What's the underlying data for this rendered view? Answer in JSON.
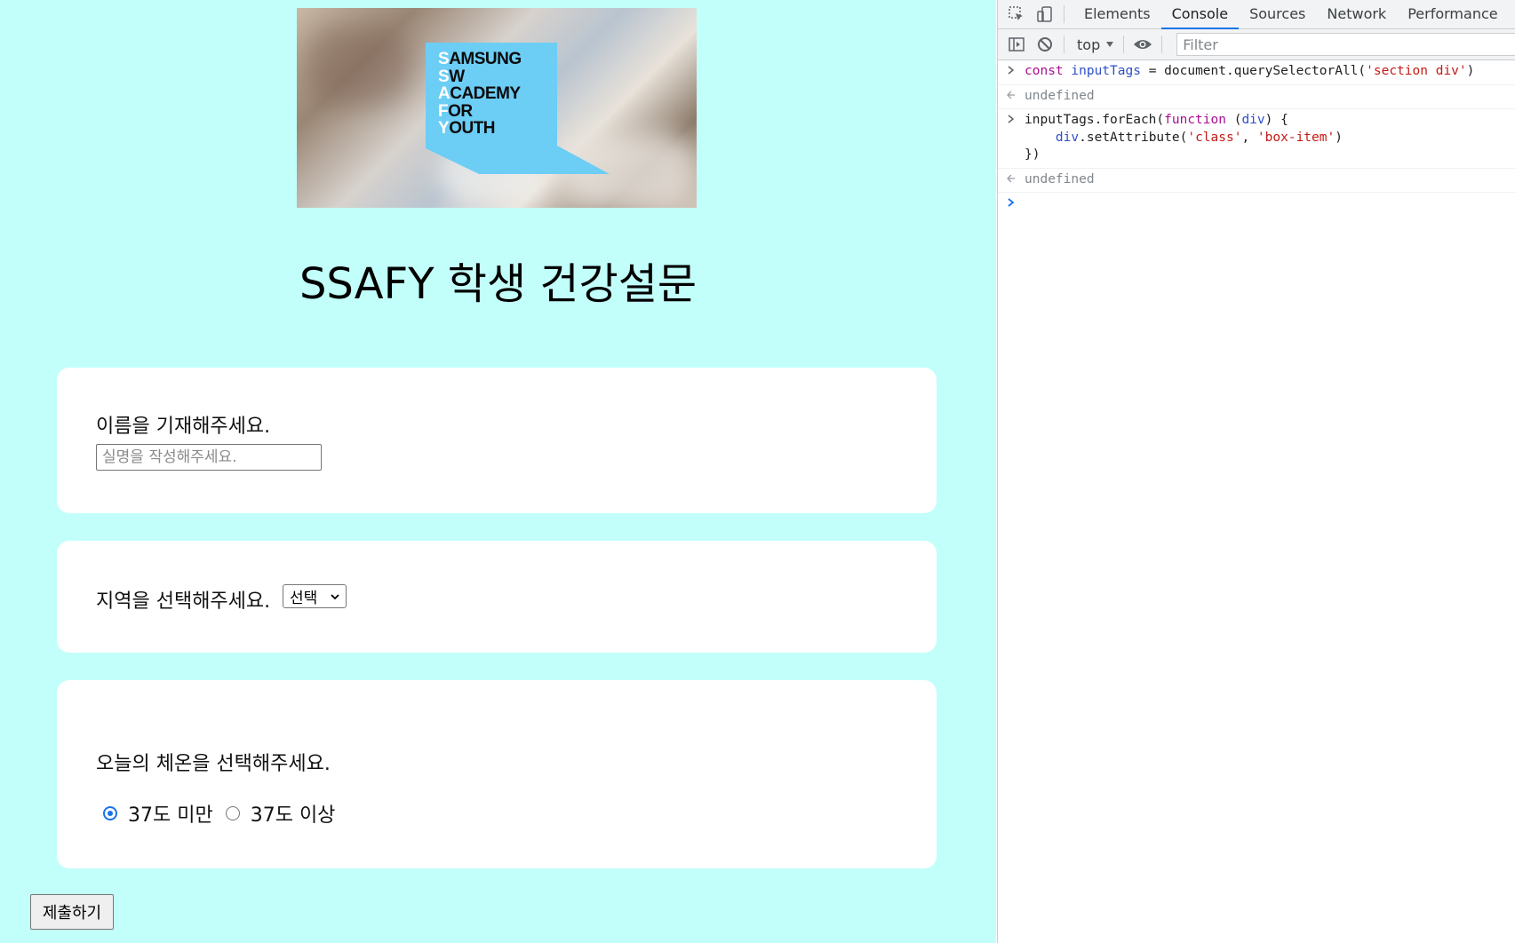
{
  "page": {
    "banner": {
      "logo_lines": [
        {
          "first": "S",
          "rest": "AMSUNG"
        },
        {
          "first": "S",
          "rest": "W"
        },
        {
          "first": "A",
          "rest": "CADEMY"
        },
        {
          "first": "F",
          "rest": "OR"
        },
        {
          "first": "Y",
          "rest": "OUTH"
        }
      ]
    },
    "title": "SSAFY 학생 건강설문",
    "name_question": {
      "label": "이름을 기재해주세요.",
      "placeholder": "실명을 작성해주세요.",
      "value": ""
    },
    "region_question": {
      "label": "지역을 선택해주세요.",
      "selected": "선택"
    },
    "temperature_question": {
      "label": "오늘의 체온을 선택해주세요.",
      "options": [
        {
          "label": "37도 미만",
          "checked": true
        },
        {
          "label": "37도 이상",
          "checked": false
        }
      ]
    },
    "submit_label": "제출하기",
    "background_color": "#c2fffa"
  },
  "devtools": {
    "tabs": [
      "Elements",
      "Console",
      "Sources",
      "Network",
      "Performance"
    ],
    "active_tab": "Console",
    "context": "top",
    "filter_placeholder": "Filter",
    "console": {
      "line1": {
        "kw": "const",
        "var": "inputTags",
        "op": " = document.querySelectorAll(",
        "str": "'section div'",
        "end": ")"
      },
      "result1": "undefined",
      "line2": {
        "a": "inputTags.forEach(",
        "kw": "function",
        "b": " (",
        "param": "div",
        "c": ") {",
        "d_indent": "    ",
        "d_var": "div",
        "d_a": ".setAttribute(",
        "d_str1": "'class'",
        "d_sep": ", ",
        "d_str2": "'box-item'",
        "d_end": ")",
        "e": "})"
      },
      "result2": "undefined"
    },
    "accent_color": "#1a73e8"
  }
}
